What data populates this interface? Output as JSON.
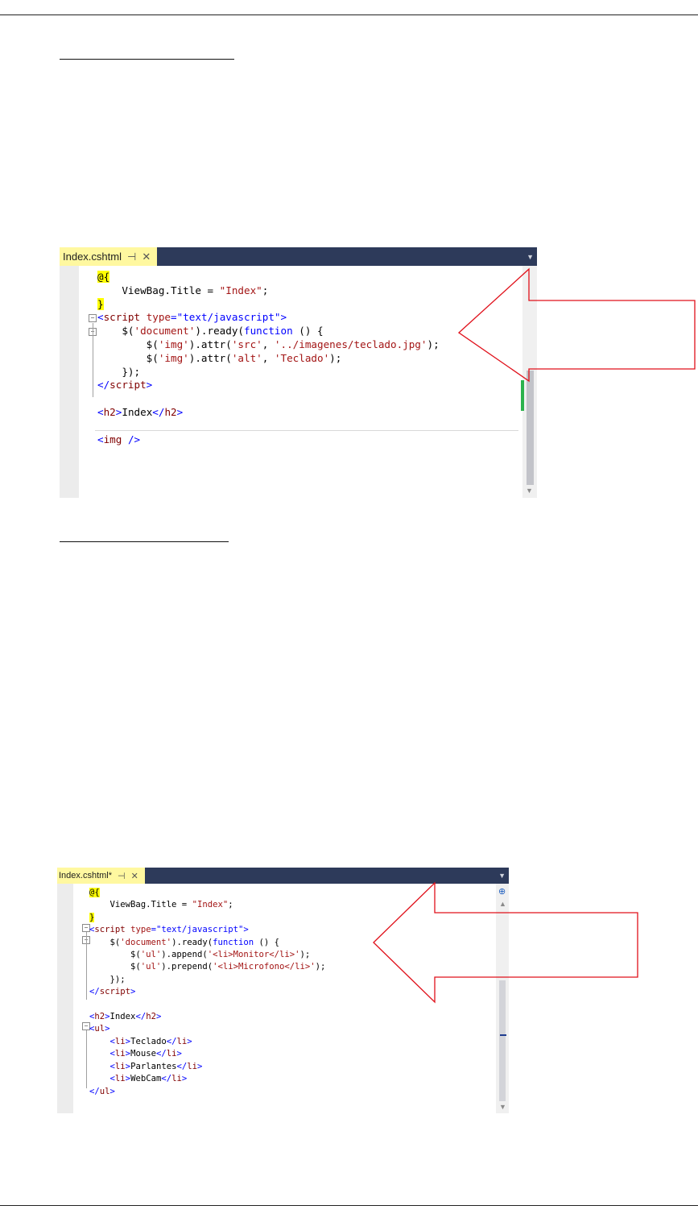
{
  "editor1": {
    "tab_label": "Index.cshtml",
    "pin_icon": "pin-icon",
    "close_icon": "close-icon",
    "lines": [
      {
        "parts": [
          {
            "c": "hl",
            "t": "@{"
          }
        ]
      },
      {
        "parts": [
          {
            "c": "",
            "t": "    ViewBag.Title = "
          },
          {
            "c": "s",
            "t": "\"Index\""
          },
          {
            "c": "",
            "t": ";"
          }
        ]
      },
      {
        "parts": [
          {
            "c": "hl",
            "t": "}"
          }
        ]
      },
      {
        "parts": [
          {
            "c": "k",
            "t": "<"
          },
          {
            "c": "t",
            "t": "script"
          },
          {
            "c": "",
            "t": " "
          },
          {
            "c": "s",
            "t": "type"
          },
          {
            "c": "k",
            "t": "=\"text/javascript\">"
          }
        ]
      },
      {
        "parts": [
          {
            "c": "",
            "t": "    $("
          },
          {
            "c": "s",
            "t": "'document'"
          },
          {
            "c": "",
            "t": ").ready("
          },
          {
            "c": "k",
            "t": "function"
          },
          {
            "c": "",
            "t": " () {"
          }
        ]
      },
      {
        "parts": [
          {
            "c": "",
            "t": "        $("
          },
          {
            "c": "s",
            "t": "'img'"
          },
          {
            "c": "",
            "t": ").attr("
          },
          {
            "c": "s",
            "t": "'src'"
          },
          {
            "c": "",
            "t": ", "
          },
          {
            "c": "s",
            "t": "'../imagenes/teclado.jpg'"
          },
          {
            "c": "",
            "t": ");"
          }
        ]
      },
      {
        "parts": [
          {
            "c": "",
            "t": "        $("
          },
          {
            "c": "s",
            "t": "'img'"
          },
          {
            "c": "",
            "t": ").attr("
          },
          {
            "c": "s",
            "t": "'alt'"
          },
          {
            "c": "",
            "t": ", "
          },
          {
            "c": "s",
            "t": "'Teclado'"
          },
          {
            "c": "",
            "t": ");"
          }
        ]
      },
      {
        "parts": [
          {
            "c": "",
            "t": "    });"
          }
        ]
      },
      {
        "parts": [
          {
            "c": "k",
            "t": "</"
          },
          {
            "c": "t",
            "t": "script"
          },
          {
            "c": "k",
            "t": ">"
          }
        ]
      },
      {
        "parts": [
          {
            "c": "",
            "t": ""
          }
        ]
      },
      {
        "parts": [
          {
            "c": "k",
            "t": "<"
          },
          {
            "c": "t",
            "t": "h2"
          },
          {
            "c": "k",
            "t": ">"
          },
          {
            "c": "",
            "t": "Index"
          },
          {
            "c": "k",
            "t": "</"
          },
          {
            "c": "t",
            "t": "h2"
          },
          {
            "c": "k",
            "t": ">"
          }
        ]
      },
      {
        "parts": [
          {
            "c": "",
            "t": ""
          }
        ]
      },
      {
        "parts": [
          {
            "c": "k",
            "t": "<"
          },
          {
            "c": "t",
            "t": "img"
          },
          {
            "c": "",
            "t": " "
          },
          {
            "c": "k",
            "t": "/>"
          }
        ]
      }
    ]
  },
  "editor2": {
    "tab_label": "Index.cshtml*",
    "pin_icon": "pin-icon",
    "close_icon": "close-icon",
    "lines": [
      {
        "parts": [
          {
            "c": "hl",
            "t": "@{"
          }
        ]
      },
      {
        "parts": [
          {
            "c": "",
            "t": "    ViewBag.Title = "
          },
          {
            "c": "s",
            "t": "\"Index\""
          },
          {
            "c": "",
            "t": ";"
          }
        ]
      },
      {
        "parts": [
          {
            "c": "hl",
            "t": "}"
          }
        ]
      },
      {
        "parts": [
          {
            "c": "k",
            "t": "<"
          },
          {
            "c": "t",
            "t": "script"
          },
          {
            "c": "",
            "t": " "
          },
          {
            "c": "s",
            "t": "type"
          },
          {
            "c": "k",
            "t": "=\"text/javascript\">"
          }
        ]
      },
      {
        "parts": [
          {
            "c": "",
            "t": "    $("
          },
          {
            "c": "s",
            "t": "'document'"
          },
          {
            "c": "",
            "t": ").ready("
          },
          {
            "c": "k",
            "t": "function"
          },
          {
            "c": "",
            "t": " () {"
          }
        ]
      },
      {
        "parts": [
          {
            "c": "",
            "t": "        $("
          },
          {
            "c": "s",
            "t": "'ul'"
          },
          {
            "c": "",
            "t": ").append("
          },
          {
            "c": "s",
            "t": "'<li>Monitor</li>'"
          },
          {
            "c": "",
            "t": ");"
          }
        ]
      },
      {
        "parts": [
          {
            "c": "",
            "t": "        $("
          },
          {
            "c": "s",
            "t": "'ul'"
          },
          {
            "c": "",
            "t": ").prepend("
          },
          {
            "c": "s",
            "t": "'<li>Microfono</li>'"
          },
          {
            "c": "",
            "t": ");"
          }
        ]
      },
      {
        "parts": [
          {
            "c": "",
            "t": "    });"
          }
        ]
      },
      {
        "parts": [
          {
            "c": "k",
            "t": "</"
          },
          {
            "c": "t",
            "t": "script"
          },
          {
            "c": "k",
            "t": ">"
          }
        ]
      },
      {
        "parts": [
          {
            "c": "",
            "t": ""
          }
        ]
      },
      {
        "parts": [
          {
            "c": "k",
            "t": "<"
          },
          {
            "c": "t",
            "t": "h2"
          },
          {
            "c": "k",
            "t": ">"
          },
          {
            "c": "",
            "t": "Index"
          },
          {
            "c": "k",
            "t": "</"
          },
          {
            "c": "t",
            "t": "h2"
          },
          {
            "c": "k",
            "t": ">"
          }
        ]
      },
      {
        "parts": [
          {
            "c": "k",
            "t": "<"
          },
          {
            "c": "t",
            "t": "ul"
          },
          {
            "c": "k",
            "t": ">"
          }
        ]
      },
      {
        "parts": [
          {
            "c": "",
            "t": "    "
          },
          {
            "c": "k",
            "t": "<"
          },
          {
            "c": "t",
            "t": "li"
          },
          {
            "c": "k",
            "t": ">"
          },
          {
            "c": "",
            "t": "Teclado"
          },
          {
            "c": "k",
            "t": "</"
          },
          {
            "c": "t",
            "t": "li"
          },
          {
            "c": "k",
            "t": ">"
          }
        ]
      },
      {
        "parts": [
          {
            "c": "",
            "t": "    "
          },
          {
            "c": "k",
            "t": "<"
          },
          {
            "c": "t",
            "t": "li"
          },
          {
            "c": "k",
            "t": ">"
          },
          {
            "c": "",
            "t": "Mouse"
          },
          {
            "c": "k",
            "t": "</"
          },
          {
            "c": "t",
            "t": "li"
          },
          {
            "c": "k",
            "t": ">"
          }
        ]
      },
      {
        "parts": [
          {
            "c": "",
            "t": "    "
          },
          {
            "c": "k",
            "t": "<"
          },
          {
            "c": "t",
            "t": "li"
          },
          {
            "c": "k",
            "t": ">"
          },
          {
            "c": "",
            "t": "Parlantes"
          },
          {
            "c": "k",
            "t": "</"
          },
          {
            "c": "t",
            "t": "li"
          },
          {
            "c": "k",
            "t": ">"
          }
        ]
      },
      {
        "parts": [
          {
            "c": "",
            "t": "    "
          },
          {
            "c": "k",
            "t": "<"
          },
          {
            "c": "t",
            "t": "li"
          },
          {
            "c": "k",
            "t": ">"
          },
          {
            "c": "",
            "t": "WebCam"
          },
          {
            "c": "k",
            "t": "</"
          },
          {
            "c": "t",
            "t": "li"
          },
          {
            "c": "k",
            "t": ">"
          }
        ]
      },
      {
        "parts": [
          {
            "c": "k",
            "t": "</"
          },
          {
            "c": "t",
            "t": "ul"
          },
          {
            "c": "k",
            "t": ">"
          }
        ]
      }
    ]
  },
  "colors": {
    "tab_bar": "#2d3a5a",
    "tab_active": "#fff8a0",
    "arrow_stroke": "#e0101a",
    "keyword": "#0000ff",
    "string": "#a31515",
    "tag": "#800000",
    "highlight": "#ffff00"
  }
}
